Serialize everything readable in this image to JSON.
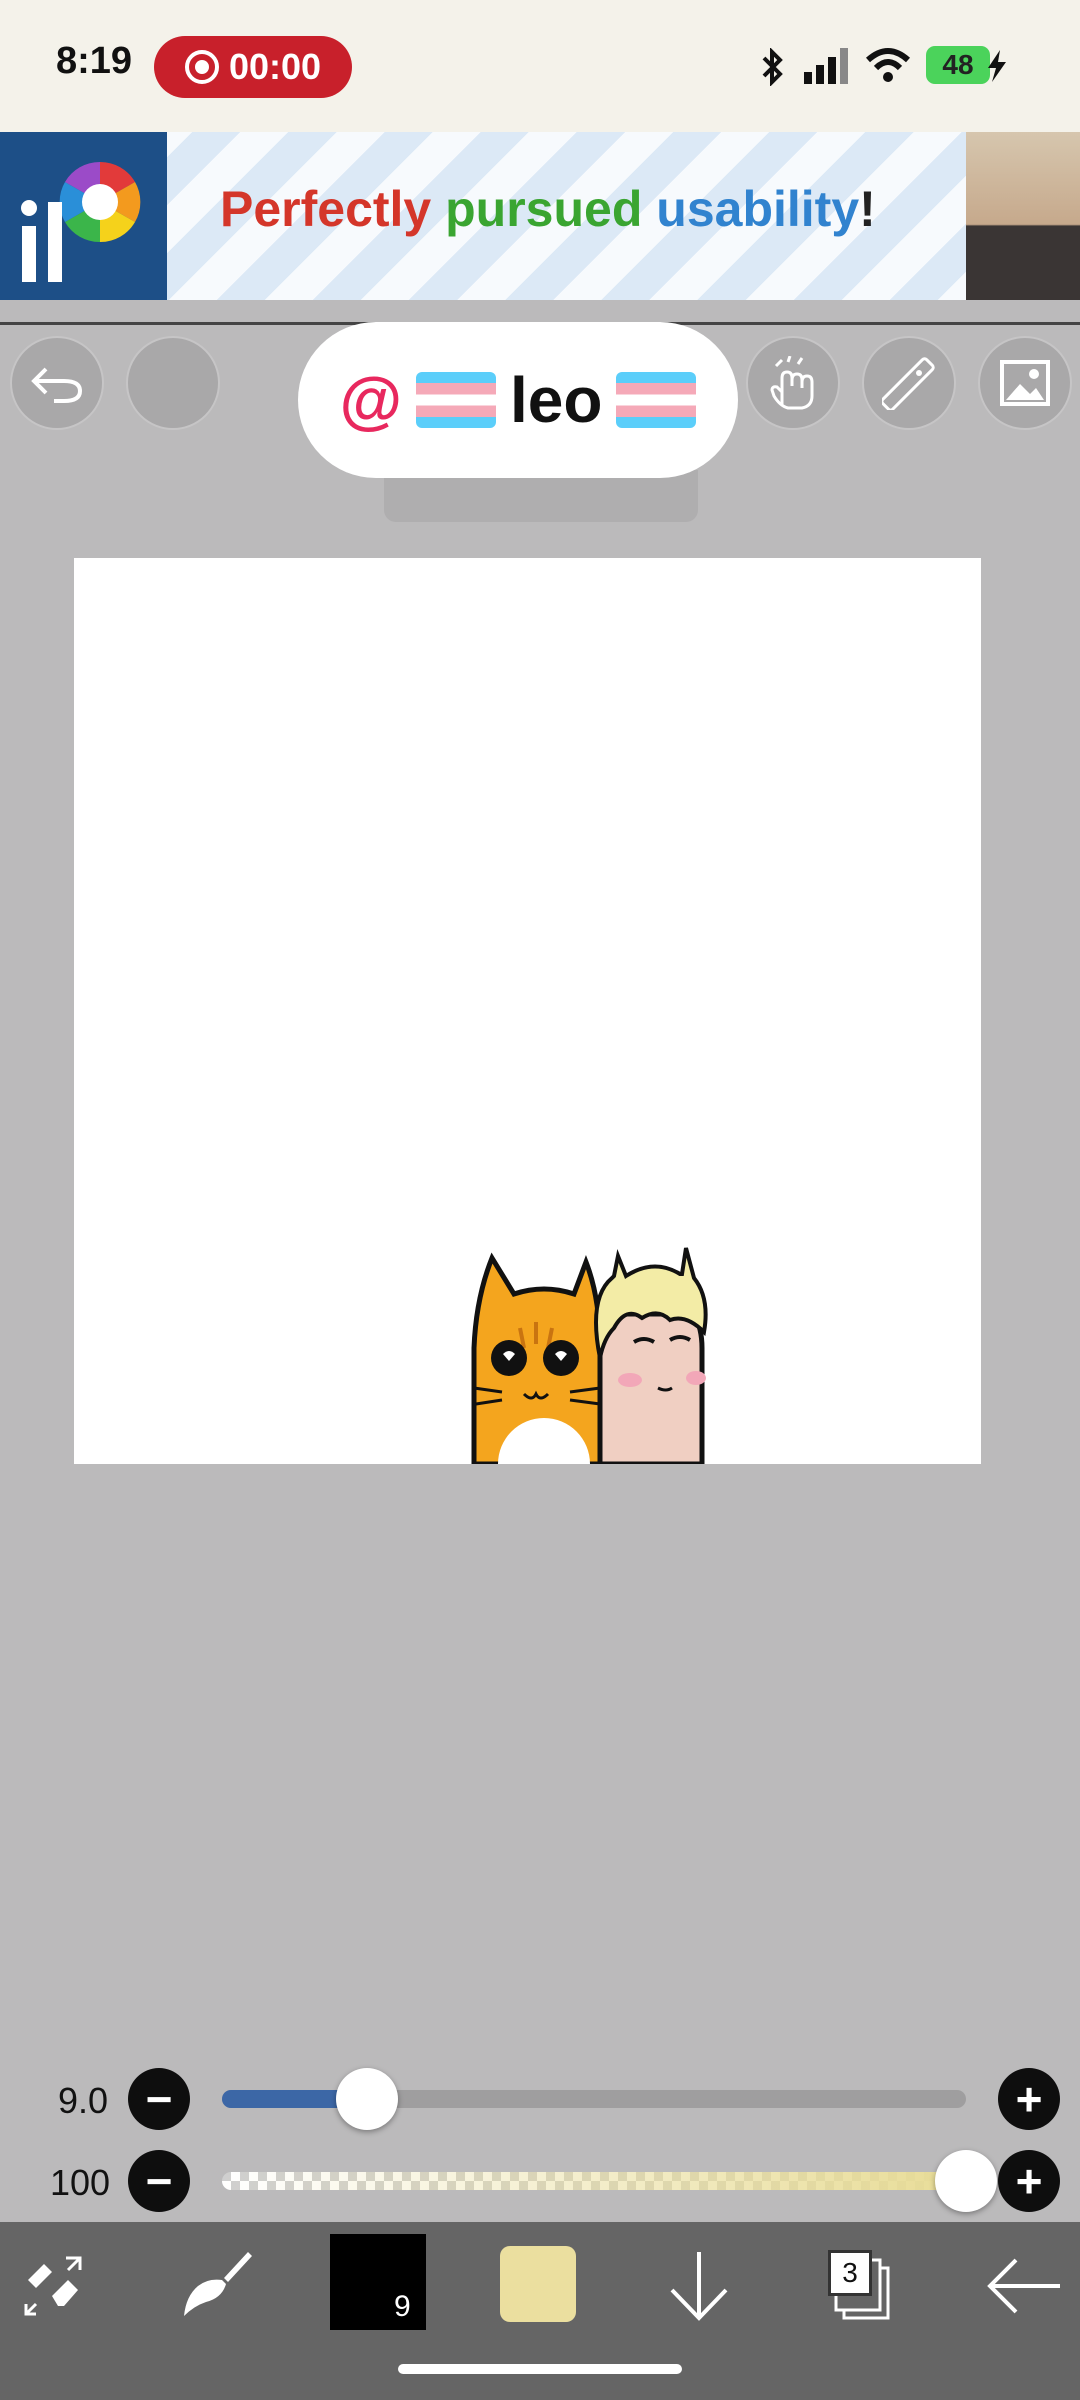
{
  "status_bar": {
    "time": "8:19",
    "recording_timer": "00:00",
    "battery": "48",
    "icons": [
      "bluetooth-icon",
      "signal-icon",
      "wifi-icon",
      "charging-icon"
    ]
  },
  "ad_banner": {
    "word1": "Perfectly",
    "word2": "pursued",
    "word3": "usability",
    "word4": "!",
    "colors": {
      "word1": "#d4362a",
      "word2": "#3aa531",
      "word3": "#3183cf",
      "word4": "#222222"
    }
  },
  "toolbar": {
    "left_icons": [
      "undo-icon",
      "blank-circle"
    ],
    "right_icons": [
      "hand-icon",
      "ruler-icon",
      "image-icon"
    ],
    "user_name": "leo",
    "at_symbol": "@"
  },
  "sliders": {
    "brush_size_label": "9.0",
    "brush_size_fraction": 0.195,
    "opacity_label": "100",
    "opacity_fraction": 1.0
  },
  "bottom_bar": {
    "brush_size_badge": "9",
    "layer_count": "3",
    "current_color": "#ebdf9f",
    "icons": [
      "transform-icon",
      "brush-icon",
      "color-swatch",
      "move-down-icon",
      "layers-icon",
      "back-arrow-icon"
    ]
  }
}
